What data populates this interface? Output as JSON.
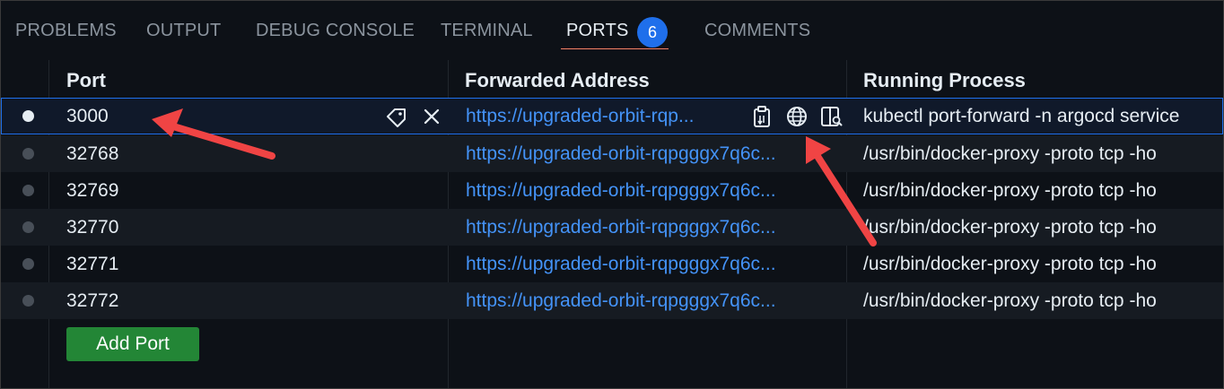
{
  "tabs": [
    {
      "label": "PROBLEMS"
    },
    {
      "label": "OUTPUT"
    },
    {
      "label": "DEBUG CONSOLE"
    },
    {
      "label": "TERMINAL"
    },
    {
      "label": "PORTS",
      "badge": "6"
    },
    {
      "label": "COMMENTS"
    }
  ],
  "columns": {
    "port": "Port",
    "address": "Forwarded Address",
    "process": "Running Process"
  },
  "rows": [
    {
      "port": "3000",
      "address": "https://upgraded-orbit-rqp...",
      "process": "kubectl port-forward -n argocd service"
    },
    {
      "port": "32768",
      "address": "https://upgraded-orbit-rqpgggx7q6c...",
      "process": "/usr/bin/docker-proxy -proto tcp -ho"
    },
    {
      "port": "32769",
      "address": "https://upgraded-orbit-rqpgggx7q6c...",
      "process": "/usr/bin/docker-proxy -proto tcp -ho"
    },
    {
      "port": "32770",
      "address": "https://upgraded-orbit-rqpgggx7q6c...",
      "process": "/usr/bin/docker-proxy -proto tcp -ho"
    },
    {
      "port": "32771",
      "address": "https://upgraded-orbit-rqpgggx7q6c...",
      "process": "/usr/bin/docker-proxy -proto tcp -ho"
    },
    {
      "port": "32772",
      "address": "https://upgraded-orbit-rqpgggx7q6c...",
      "process": "/usr/bin/docker-proxy -proto tcp -ho"
    }
  ],
  "add_port_label": "Add Port",
  "colors": {
    "accent": "#1f6feb",
    "link": "#4493f8",
    "button": "#238636",
    "annotation_arrow": "#f04444"
  },
  "icons": [
    "label-tag-icon",
    "close-icon",
    "copy-address-icon",
    "open-in-browser-globe-icon",
    "preview-in-editor-icon"
  ]
}
